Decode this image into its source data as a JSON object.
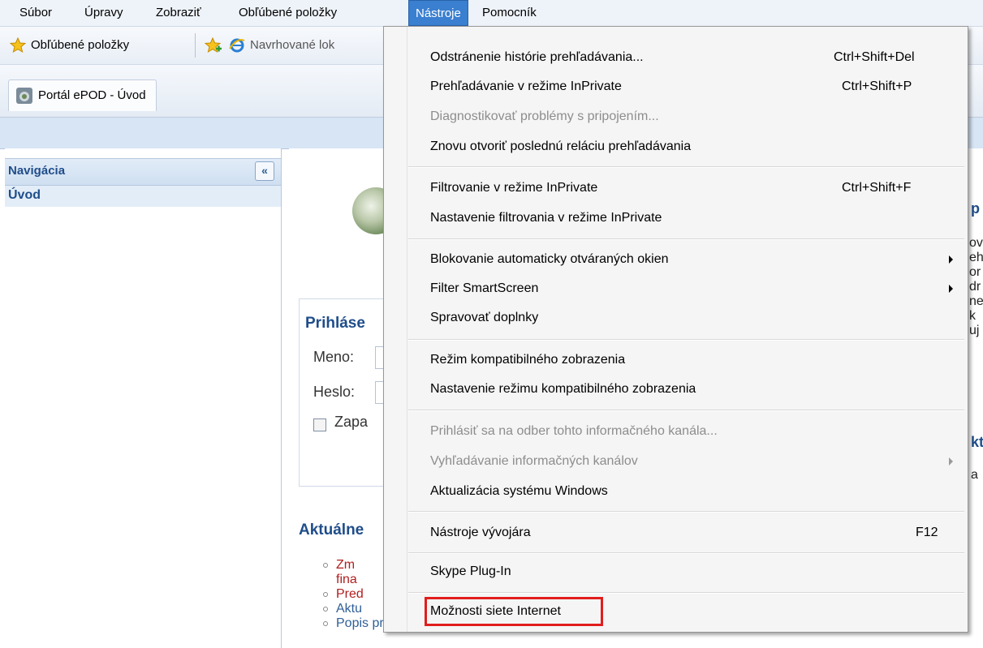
{
  "menubar": {
    "items": [
      "Súbor",
      "Úpravy",
      "Zobraziť",
      "Obľúbené položky",
      "Nástroje",
      "Pomocník"
    ],
    "active": "Nástroje"
  },
  "favorites_bar": {
    "favorites_label": "Obľúbené položky",
    "suggested_label": "Navrhované lok"
  },
  "tab": {
    "title": "Portál ePOD - Úvod"
  },
  "navigation": {
    "title": "Navigácia",
    "collapse_glyph": "«",
    "home": "Úvod"
  },
  "content": {
    "login_title": "Prihláse",
    "name_label": "Meno:",
    "password_label": "Heslo:",
    "remember_label": "Zapa",
    "news_title": "Aktuálne",
    "news": [
      {
        "line1": "Zm",
        "line2": "fina",
        "color": "#b01e1e"
      },
      {
        "line1": "Pred",
        "color": "#b01e1e"
      },
      {
        "line1": "Aktu",
        "color": "#2f5f96"
      },
      {
        "line1": "Popis projektu",
        "color": "#2f5f96"
      }
    ],
    "right_fragments": [
      "p",
      "ov",
      "eh",
      "or",
      "dr",
      "ne",
      "k",
      "uj",
      "kt",
      "a"
    ]
  },
  "tools_menu": {
    "items": [
      {
        "label": "Odstránenie histórie prehľadávania...",
        "shortcut": "Ctrl+Shift+Del"
      },
      {
        "label": "Prehľadávanie v režime InPrivate",
        "shortcut": "Ctrl+Shift+P"
      },
      {
        "label": "Diagnostikovať problémy s pripojením...",
        "disabled": true
      },
      {
        "label": "Znovu otvoriť poslednú reláciu prehľadávania"
      },
      {
        "label": "Filtrovanie v režime InPrivate",
        "shortcut": "Ctrl+Shift+F"
      },
      {
        "label": "Nastavenie filtrovania v režime InPrivate"
      },
      {
        "label": "Blokovanie automaticky otváraných okien",
        "submenu": true
      },
      {
        "label": "Filter SmartScreen",
        "submenu": true
      },
      {
        "label": "Spravovať doplnky"
      },
      {
        "label": "Režim kompatibilného zobrazenia"
      },
      {
        "label": "Nastavenie režimu kompatibilného zobrazenia"
      },
      {
        "label": "Prihlásiť sa na odber tohto informačného kanála...",
        "disabled": true
      },
      {
        "label": "Vyhľadávanie informačných kanálov",
        "disabled": true,
        "submenu": true
      },
      {
        "label": "Aktualizácia systému Windows"
      },
      {
        "label": "Nástroje vývojára",
        "shortcut": "F12"
      },
      {
        "label": "Skype Plug-In"
      },
      {
        "label": "Možnosti siete Internet",
        "highlighted": true
      }
    ]
  }
}
